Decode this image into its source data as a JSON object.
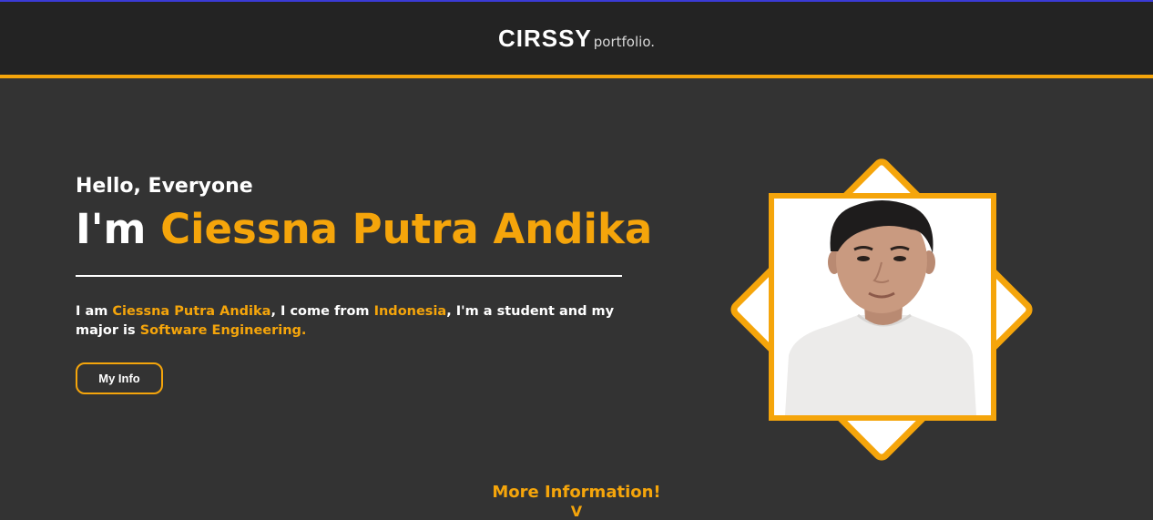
{
  "header": {
    "brand_main": "CIRSSY",
    "brand_sub": "portfolio."
  },
  "hero": {
    "greeting": "Hello, Everyone",
    "title_prefix": "I'm ",
    "title_name": "Ciessna Putra Andika",
    "desc": {
      "part1": "I am ",
      "name": "Ciessna Putra Andika",
      "part2": ", I come from ",
      "country": "Indonesia",
      "part3": ", I'm a student and my major is ",
      "major": "Software Engineering."
    },
    "button_label": "My Info"
  },
  "more": {
    "label": "More Information!",
    "arrow": "V"
  },
  "colors": {
    "accent": "#f5a50b",
    "background": "#333333",
    "header_bg": "#232323"
  },
  "icons": {
    "profile": "profile-photo"
  }
}
